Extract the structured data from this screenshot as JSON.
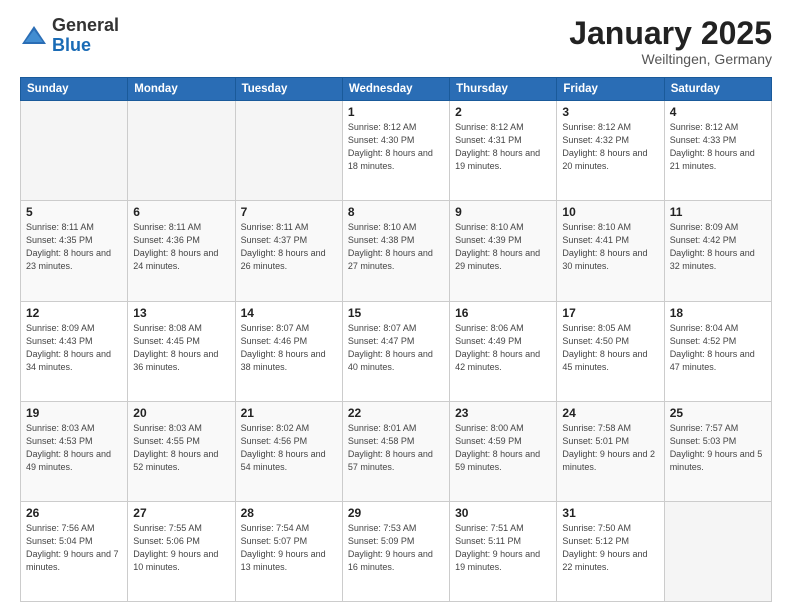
{
  "logo": {
    "general": "General",
    "blue": "Blue"
  },
  "header": {
    "month": "January 2025",
    "location": "Weiltingen, Germany"
  },
  "weekdays": [
    "Sunday",
    "Monday",
    "Tuesday",
    "Wednesday",
    "Thursday",
    "Friday",
    "Saturday"
  ],
  "weeks": [
    [
      {
        "day": "",
        "sunrise": "",
        "sunset": "",
        "daylight": ""
      },
      {
        "day": "",
        "sunrise": "",
        "sunset": "",
        "daylight": ""
      },
      {
        "day": "",
        "sunrise": "",
        "sunset": "",
        "daylight": ""
      },
      {
        "day": "1",
        "sunrise": "Sunrise: 8:12 AM",
        "sunset": "Sunset: 4:30 PM",
        "daylight": "Daylight: 8 hours and 18 minutes."
      },
      {
        "day": "2",
        "sunrise": "Sunrise: 8:12 AM",
        "sunset": "Sunset: 4:31 PM",
        "daylight": "Daylight: 8 hours and 19 minutes."
      },
      {
        "day": "3",
        "sunrise": "Sunrise: 8:12 AM",
        "sunset": "Sunset: 4:32 PM",
        "daylight": "Daylight: 8 hours and 20 minutes."
      },
      {
        "day": "4",
        "sunrise": "Sunrise: 8:12 AM",
        "sunset": "Sunset: 4:33 PM",
        "daylight": "Daylight: 8 hours and 21 minutes."
      }
    ],
    [
      {
        "day": "5",
        "sunrise": "Sunrise: 8:11 AM",
        "sunset": "Sunset: 4:35 PM",
        "daylight": "Daylight: 8 hours and 23 minutes."
      },
      {
        "day": "6",
        "sunrise": "Sunrise: 8:11 AM",
        "sunset": "Sunset: 4:36 PM",
        "daylight": "Daylight: 8 hours and 24 minutes."
      },
      {
        "day": "7",
        "sunrise": "Sunrise: 8:11 AM",
        "sunset": "Sunset: 4:37 PM",
        "daylight": "Daylight: 8 hours and 26 minutes."
      },
      {
        "day": "8",
        "sunrise": "Sunrise: 8:10 AM",
        "sunset": "Sunset: 4:38 PM",
        "daylight": "Daylight: 8 hours and 27 minutes."
      },
      {
        "day": "9",
        "sunrise": "Sunrise: 8:10 AM",
        "sunset": "Sunset: 4:39 PM",
        "daylight": "Daylight: 8 hours and 29 minutes."
      },
      {
        "day": "10",
        "sunrise": "Sunrise: 8:10 AM",
        "sunset": "Sunset: 4:41 PM",
        "daylight": "Daylight: 8 hours and 30 minutes."
      },
      {
        "day": "11",
        "sunrise": "Sunrise: 8:09 AM",
        "sunset": "Sunset: 4:42 PM",
        "daylight": "Daylight: 8 hours and 32 minutes."
      }
    ],
    [
      {
        "day": "12",
        "sunrise": "Sunrise: 8:09 AM",
        "sunset": "Sunset: 4:43 PM",
        "daylight": "Daylight: 8 hours and 34 minutes."
      },
      {
        "day": "13",
        "sunrise": "Sunrise: 8:08 AM",
        "sunset": "Sunset: 4:45 PM",
        "daylight": "Daylight: 8 hours and 36 minutes."
      },
      {
        "day": "14",
        "sunrise": "Sunrise: 8:07 AM",
        "sunset": "Sunset: 4:46 PM",
        "daylight": "Daylight: 8 hours and 38 minutes."
      },
      {
        "day": "15",
        "sunrise": "Sunrise: 8:07 AM",
        "sunset": "Sunset: 4:47 PM",
        "daylight": "Daylight: 8 hours and 40 minutes."
      },
      {
        "day": "16",
        "sunrise": "Sunrise: 8:06 AM",
        "sunset": "Sunset: 4:49 PM",
        "daylight": "Daylight: 8 hours and 42 minutes."
      },
      {
        "day": "17",
        "sunrise": "Sunrise: 8:05 AM",
        "sunset": "Sunset: 4:50 PM",
        "daylight": "Daylight: 8 hours and 45 minutes."
      },
      {
        "day": "18",
        "sunrise": "Sunrise: 8:04 AM",
        "sunset": "Sunset: 4:52 PM",
        "daylight": "Daylight: 8 hours and 47 minutes."
      }
    ],
    [
      {
        "day": "19",
        "sunrise": "Sunrise: 8:03 AM",
        "sunset": "Sunset: 4:53 PM",
        "daylight": "Daylight: 8 hours and 49 minutes."
      },
      {
        "day": "20",
        "sunrise": "Sunrise: 8:03 AM",
        "sunset": "Sunset: 4:55 PM",
        "daylight": "Daylight: 8 hours and 52 minutes."
      },
      {
        "day": "21",
        "sunrise": "Sunrise: 8:02 AM",
        "sunset": "Sunset: 4:56 PM",
        "daylight": "Daylight: 8 hours and 54 minutes."
      },
      {
        "day": "22",
        "sunrise": "Sunrise: 8:01 AM",
        "sunset": "Sunset: 4:58 PM",
        "daylight": "Daylight: 8 hours and 57 minutes."
      },
      {
        "day": "23",
        "sunrise": "Sunrise: 8:00 AM",
        "sunset": "Sunset: 4:59 PM",
        "daylight": "Daylight: 8 hours and 59 minutes."
      },
      {
        "day": "24",
        "sunrise": "Sunrise: 7:58 AM",
        "sunset": "Sunset: 5:01 PM",
        "daylight": "Daylight: 9 hours and 2 minutes."
      },
      {
        "day": "25",
        "sunrise": "Sunrise: 7:57 AM",
        "sunset": "Sunset: 5:03 PM",
        "daylight": "Daylight: 9 hours and 5 minutes."
      }
    ],
    [
      {
        "day": "26",
        "sunrise": "Sunrise: 7:56 AM",
        "sunset": "Sunset: 5:04 PM",
        "daylight": "Daylight: 9 hours and 7 minutes."
      },
      {
        "day": "27",
        "sunrise": "Sunrise: 7:55 AM",
        "sunset": "Sunset: 5:06 PM",
        "daylight": "Daylight: 9 hours and 10 minutes."
      },
      {
        "day": "28",
        "sunrise": "Sunrise: 7:54 AM",
        "sunset": "Sunset: 5:07 PM",
        "daylight": "Daylight: 9 hours and 13 minutes."
      },
      {
        "day": "29",
        "sunrise": "Sunrise: 7:53 AM",
        "sunset": "Sunset: 5:09 PM",
        "daylight": "Daylight: 9 hours and 16 minutes."
      },
      {
        "day": "30",
        "sunrise": "Sunrise: 7:51 AM",
        "sunset": "Sunset: 5:11 PM",
        "daylight": "Daylight: 9 hours and 19 minutes."
      },
      {
        "day": "31",
        "sunrise": "Sunrise: 7:50 AM",
        "sunset": "Sunset: 5:12 PM",
        "daylight": "Daylight: 9 hours and 22 minutes."
      },
      {
        "day": "",
        "sunrise": "",
        "sunset": "",
        "daylight": ""
      }
    ]
  ]
}
